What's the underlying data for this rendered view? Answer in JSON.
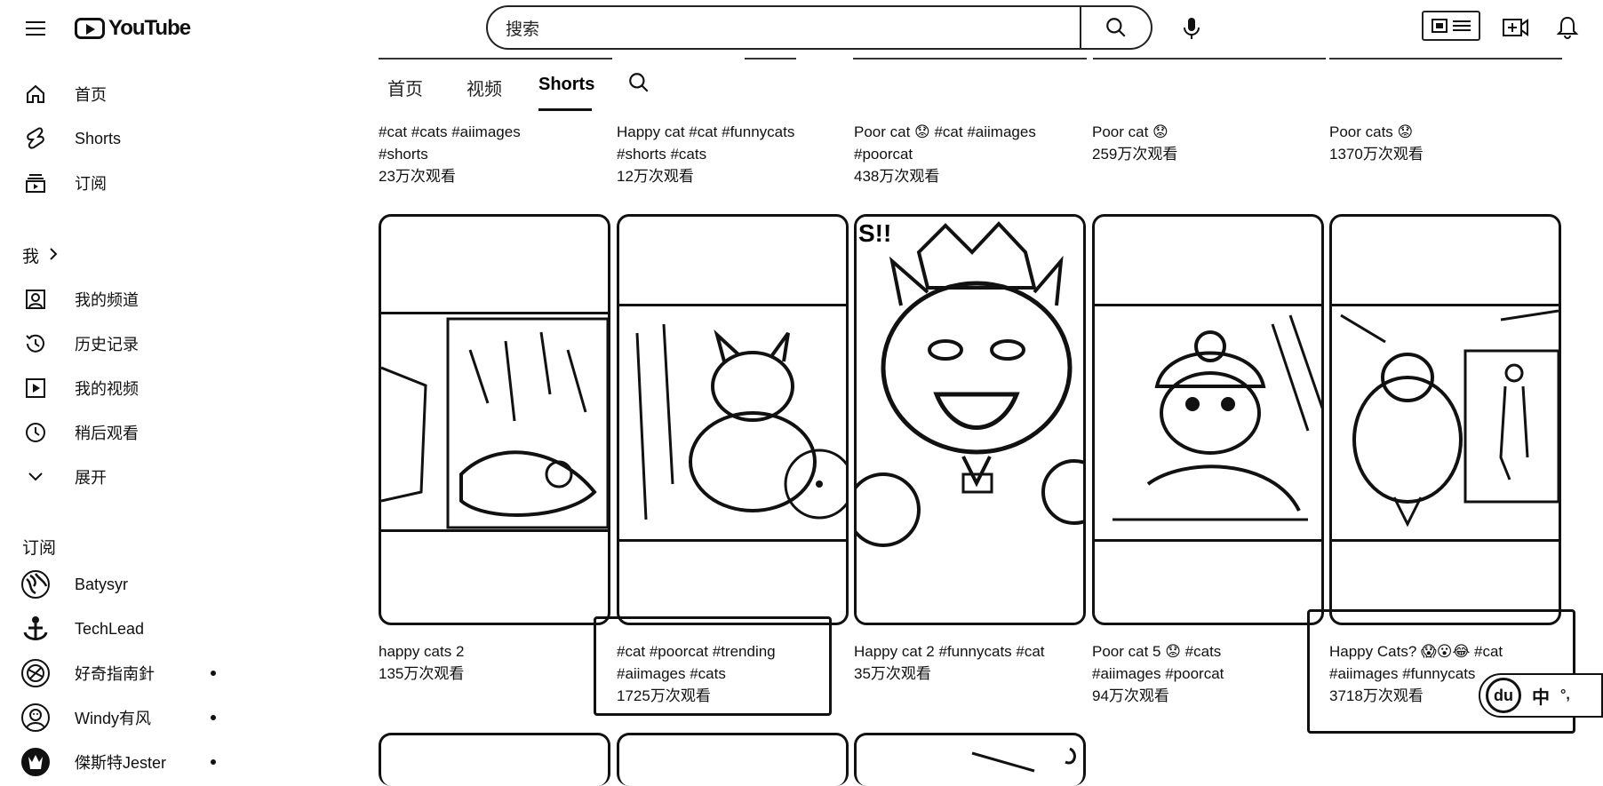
{
  "app": {
    "logo_text": "YouTube"
  },
  "search": {
    "placeholder": "搜索"
  },
  "sidebar": {
    "top_items": [
      {
        "label": "首页",
        "icon": "home-icon"
      },
      {
        "label": "Shorts",
        "icon": "shorts-icon"
      },
      {
        "label": "订阅",
        "icon": "subscriptions-icon"
      }
    ],
    "you_heading": "我",
    "you_items": [
      {
        "label": "我的频道",
        "icon": "your-channel-icon"
      },
      {
        "label": "历史记录",
        "icon": "history-icon"
      },
      {
        "label": "我的视频",
        "icon": "your-videos-icon"
      },
      {
        "label": "稍后观看",
        "icon": "watch-later-icon"
      },
      {
        "label": "展开",
        "icon": "chevron-down-icon"
      }
    ],
    "subs_heading": "订阅",
    "subscriptions": [
      {
        "label": "Batysyr",
        "new": false
      },
      {
        "label": "TechLead",
        "new": false
      },
      {
        "label": "好奇指南針",
        "new": true
      },
      {
        "label": "Windy有风",
        "new": true
      },
      {
        "label": "傑斯特Jester",
        "new": true
      }
    ]
  },
  "tabs": [
    {
      "label": "首页",
      "active": false
    },
    {
      "label": "视频",
      "active": false
    },
    {
      "label": "Shorts",
      "active": true
    }
  ],
  "row1": [
    {
      "title1": "#cat #cats #aiimages",
      "title2": "#shorts",
      "views": "23万次观看"
    },
    {
      "title1": "Happy cat #cat #funnycats",
      "title2": "#shorts #cats",
      "views": "12万次观看"
    },
    {
      "title1": "Poor cat 😟 #cat #aiimages",
      "title2": "#poorcat",
      "views": "438万次观看"
    },
    {
      "title1": "Poor cat 😟",
      "title2": "",
      "views": "259万次观看"
    },
    {
      "title1": "Poor cats 😟",
      "title2": "",
      "views": "1370万次观看"
    }
  ],
  "row2": [
    {
      "title1": "happy cats 2",
      "title2": "",
      "views": "135万次观看"
    },
    {
      "title1": "#cat #poorcat #trending",
      "title2": "#aiimages #cats",
      "views": "1725万次观看"
    },
    {
      "title1": "Happy cat 2 #funnycats #cat",
      "title2": "",
      "views": "35万次观看"
    },
    {
      "title1": "Poor cat 5 😟 #cats",
      "title2": "#aiimages #poorcat",
      "views": "94万次观看"
    },
    {
      "title1": "Happy Cats? 😱😮😂 #cat",
      "title2": "#aiimages #funnycats",
      "views": "3718万次观看"
    }
  ],
  "ime": {
    "badge": "du",
    "lang": "中",
    "punct": "°,"
  }
}
